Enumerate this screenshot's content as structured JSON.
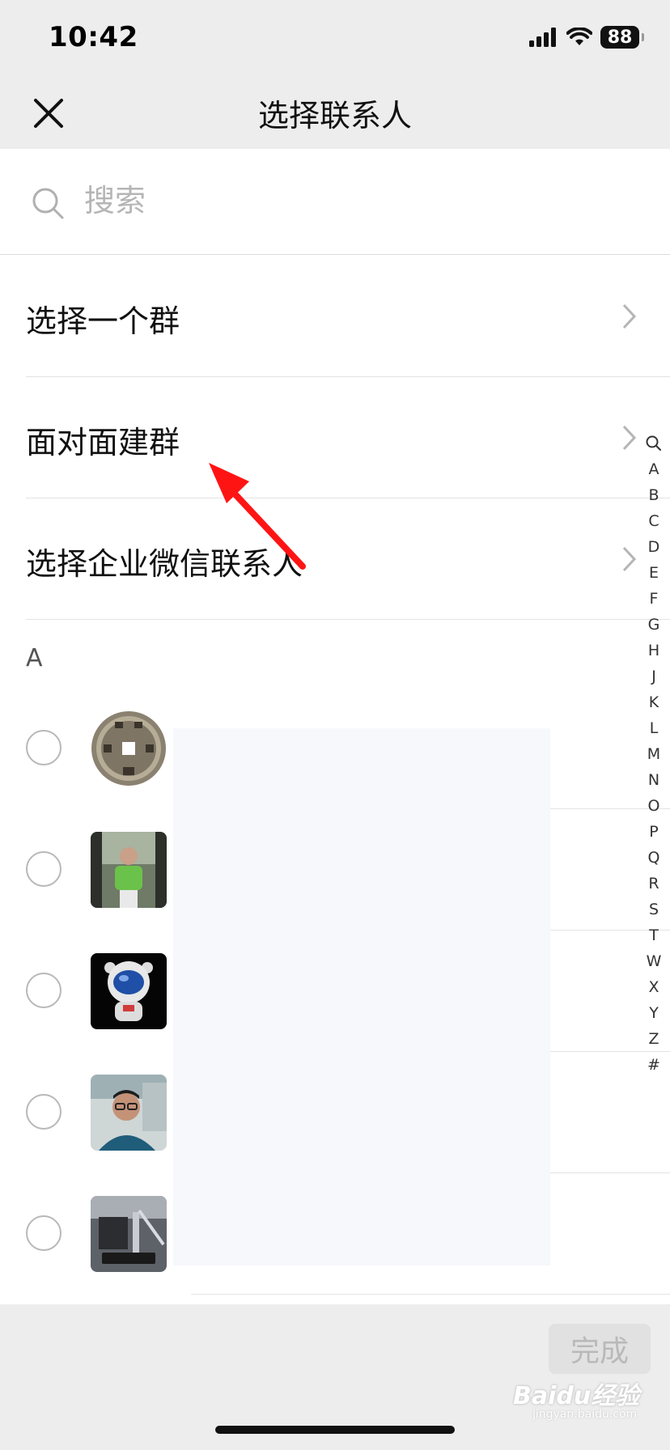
{
  "status_bar": {
    "time": "10:42",
    "battery": "88"
  },
  "nav": {
    "title": "选择联系人"
  },
  "search": {
    "placeholder": "搜索"
  },
  "menu": [
    {
      "label": "选择一个群"
    },
    {
      "label": "面对面建群"
    },
    {
      "label": "选择企业微信联系人"
    }
  ],
  "section": {
    "letter": "A"
  },
  "index_letters": [
    "A",
    "B",
    "C",
    "D",
    "E",
    "F",
    "G",
    "H",
    "J",
    "K",
    "L",
    "M",
    "N",
    "O",
    "P",
    "Q",
    "R",
    "S",
    "T",
    "W",
    "X",
    "Y",
    "Z",
    "#"
  ],
  "footer": {
    "done_label": "完成"
  },
  "watermark": {
    "brand": "Baidu经验",
    "url": "jingyan.baidu.com"
  },
  "colors": {
    "nav_bg": "#ededed",
    "annotation_arrow": "#ff1414",
    "done_disabled_bg": "#e1e1e1"
  },
  "avatars": [
    "coin-avatar",
    "man-green-shirt-avatar",
    "astronaut-avatar",
    "man-glasses-avatar",
    "machine-avatar"
  ]
}
